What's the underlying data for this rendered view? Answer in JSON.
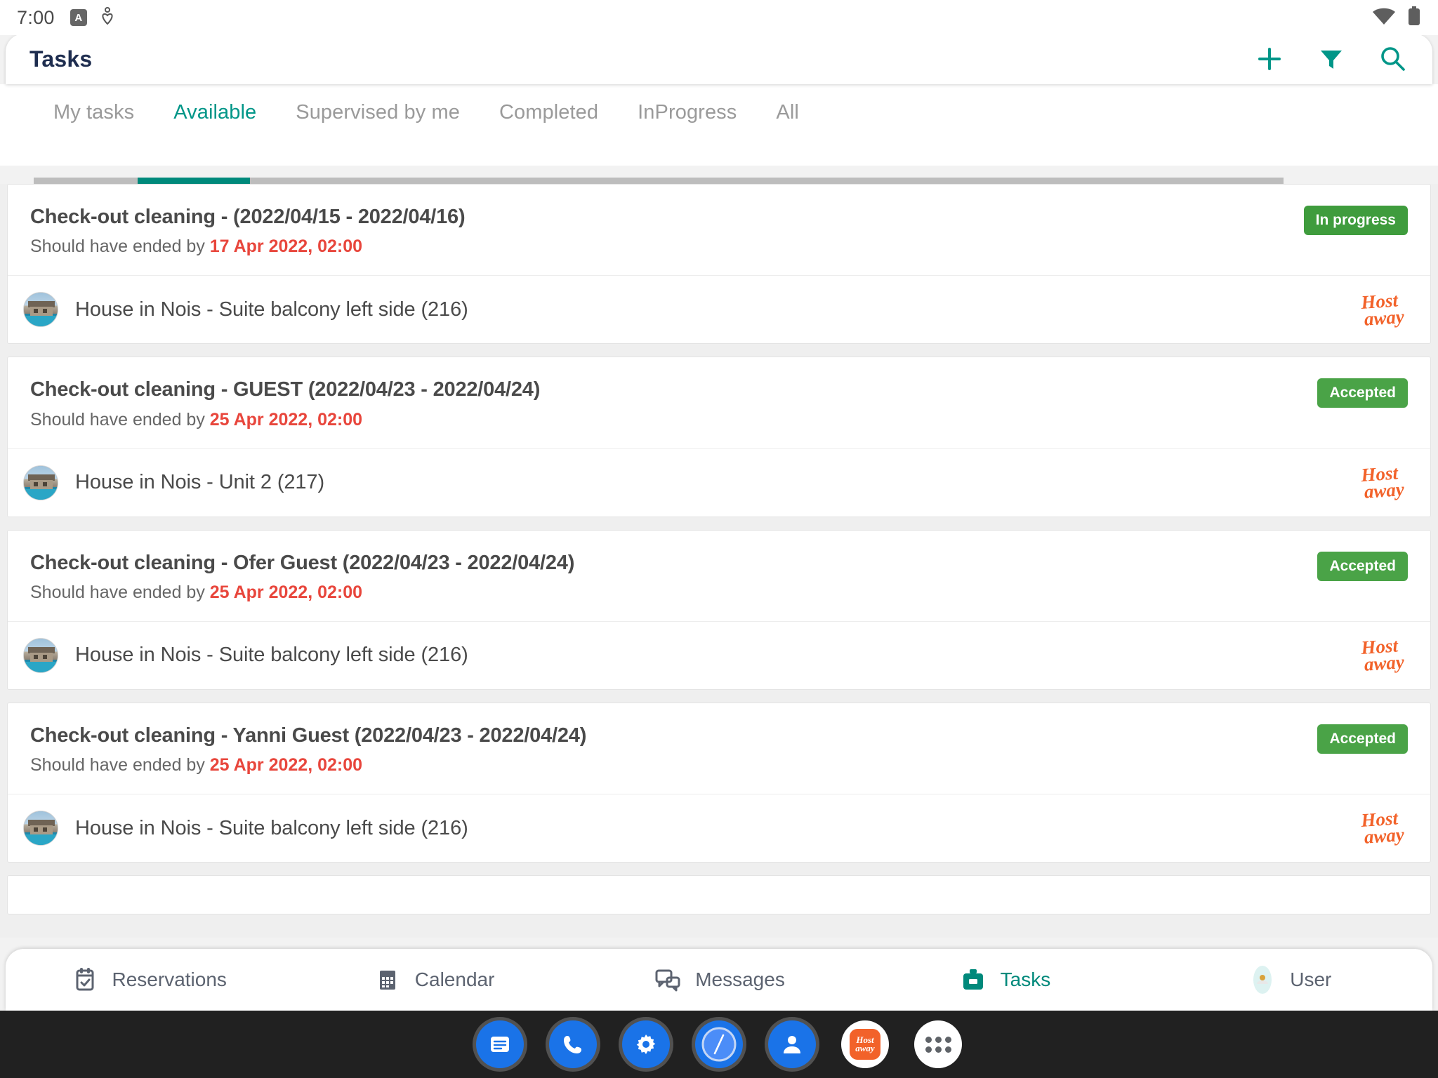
{
  "status_bar": {
    "time": "7:00",
    "icons": [
      "android-app-badge",
      "heart-pin-icon",
      "wifi-icon",
      "battery-icon"
    ]
  },
  "app_bar": {
    "title": "Tasks",
    "actions": [
      {
        "name": "add-task-button",
        "icon": "plus-icon"
      },
      {
        "name": "filter-button",
        "icon": "filter-funnel-icon"
      },
      {
        "name": "search-button",
        "icon": "search-icon"
      }
    ],
    "accent_color": "#009688",
    "title_color": "#1e2d4f"
  },
  "tabs": {
    "items": [
      {
        "label": "My tasks",
        "active": false
      },
      {
        "label": "Available",
        "active": true
      },
      {
        "label": "Supervised by me",
        "active": false
      },
      {
        "label": "Completed",
        "active": false
      },
      {
        "label": "InProgress",
        "active": false
      },
      {
        "label": "All",
        "active": false
      }
    ],
    "active_index": 1
  },
  "tasks": [
    {
      "title": "Check-out cleaning - (2022/04/15 - 2022/04/16)",
      "due_prefix": "Should have ended by ",
      "due_date": "17 Apr 2022, 02:00",
      "status": "In progress",
      "status_color": "#3f9c3d",
      "property": "House in Nois - Suite balcony left side (216)",
      "channel_logo": "hostaway-logo"
    },
    {
      "title": "Check-out cleaning - GUEST (2022/04/23 - 2022/04/24)",
      "due_prefix": "Should have ended by ",
      "due_date": "25 Apr 2022, 02:00",
      "status": "Accepted",
      "status_color": "#4aa347",
      "property": "House in Nois - Unit 2 (217)",
      "channel_logo": "hostaway-logo"
    },
    {
      "title": "Check-out cleaning - Ofer Guest (2022/04/23 - 2022/04/24)",
      "due_prefix": "Should have ended by ",
      "due_date": "25 Apr 2022, 02:00",
      "status": "Accepted",
      "status_color": "#4aa347",
      "property": "House in Nois - Suite balcony left side (216)",
      "channel_logo": "hostaway-logo"
    },
    {
      "title": "Check-out cleaning - Yanni Guest (2022/04/23 - 2022/04/24)",
      "due_prefix": "Should have ended by ",
      "due_date": "25 Apr 2022, 02:00",
      "status": "Accepted",
      "status_color": "#4aa347",
      "property": "House in Nois - Suite balcony left side (216)",
      "channel_logo": "hostaway-logo"
    }
  ],
  "hostaway": {
    "line1": "Host",
    "line2": "away",
    "color": "#f2622a"
  },
  "bottom_nav": {
    "items": [
      {
        "label": "Reservations",
        "icon": "calendar-check-icon",
        "active": false
      },
      {
        "label": "Calendar",
        "icon": "calendar-grid-icon",
        "active": false
      },
      {
        "label": "Messages",
        "icon": "chat-bubbles-icon",
        "active": false
      },
      {
        "label": "Tasks",
        "icon": "briefcase-icon",
        "active": true
      },
      {
        "label": "User",
        "icon": "user-avatar-icon",
        "active": false
      }
    ],
    "active_color": "#00897b",
    "inactive_color": "#5c6370"
  },
  "dock": {
    "apps": [
      {
        "name": "messages-app",
        "icon": "message-icon"
      },
      {
        "name": "phone-app",
        "icon": "phone-icon"
      },
      {
        "name": "settings-app",
        "icon": "gear-icon"
      },
      {
        "name": "clock-app",
        "icon": "compass-icon"
      },
      {
        "name": "contacts-app",
        "icon": "person-icon"
      },
      {
        "name": "hostaway-app",
        "icon": "hostaway-icon"
      },
      {
        "name": "app-drawer",
        "icon": "grid-dots-icon"
      }
    ]
  }
}
